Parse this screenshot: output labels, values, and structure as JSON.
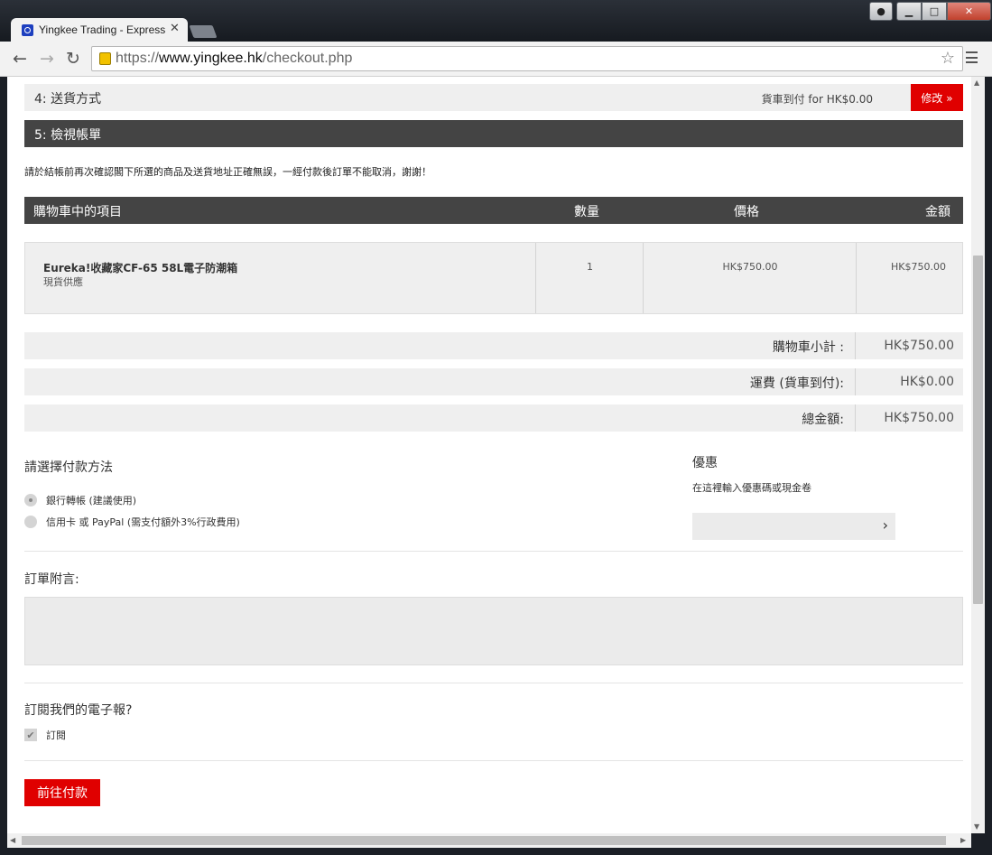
{
  "browser": {
    "tab_title": "Yingkee Trading - Express",
    "tab_close": "✕",
    "url_scheme": "https://",
    "url_host": "www.yingkee.hk",
    "url_path": "/checkout.php"
  },
  "steps": {
    "step4_label": "4: 送貨方式",
    "step4_info": "貨車到付 for HK$0.00",
    "edit_label": "修改 »",
    "step5_label": "5: 檢視帳單"
  },
  "notice": "請於結帳前再次確認閣下所選的商品及送貨地址正確無誤，一經付款後訂單不能取消，謝謝！",
  "cart": {
    "headers": {
      "item": "購物車中的項目",
      "qty": "數量",
      "price": "價格",
      "amount": "金額"
    },
    "items": [
      {
        "name": "Eureka!收藏家CF-65 58L電子防潮箱",
        "stock": "現貨供應",
        "qty": "1",
        "price": "HK$750.00",
        "amount": "HK$750.00"
      }
    ]
  },
  "totals": {
    "subtotal_label": "購物車小計 :",
    "subtotal_value": "HK$750.00",
    "shipping_label": "運費 (貨車到付):",
    "shipping_value": "HK$0.00",
    "total_label": "總金額:",
    "total_value": "HK$750.00"
  },
  "payment": {
    "title": "請選擇付款方法",
    "options": [
      {
        "label": "銀行轉帳 (建議使用)",
        "selected": true
      },
      {
        "label": "信用卡 或 PayPal (需支付額外3%行政費用)",
        "selected": false
      }
    ]
  },
  "promo": {
    "title": "優惠",
    "subtitle": "在這裡輸入優惠碼或現金卷",
    "input_value": ""
  },
  "order_note": {
    "title": "訂單附言:",
    "value": ""
  },
  "newsletter": {
    "title": "訂閱我們的電子報?",
    "checkbox_label": "訂閱",
    "checked": true
  },
  "submit_label": "前往付款",
  "colors": {
    "accent_red": "#e00000",
    "dark_bar": "#444444",
    "light_bar": "#efefef"
  }
}
